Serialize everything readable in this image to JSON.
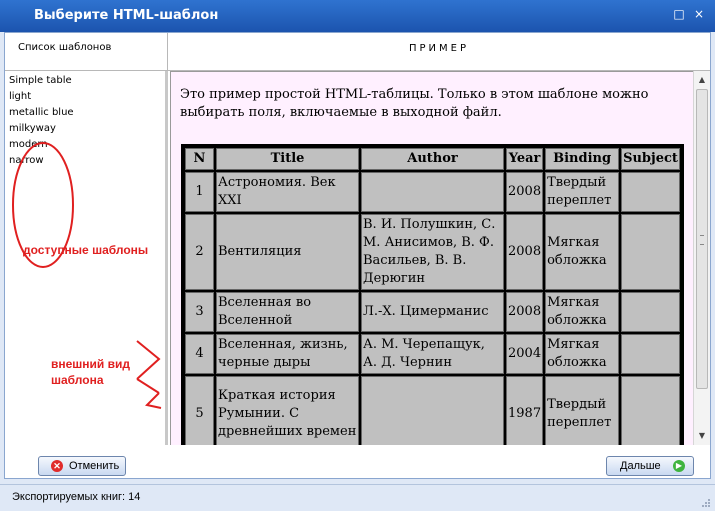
{
  "window": {
    "title": "Выберите HTML-шаблон",
    "controls": [
      "□",
      "×"
    ]
  },
  "headers": {
    "templates": "Список шаблонов",
    "preview": "ПРИМЕР"
  },
  "templates": [
    "Simple table",
    "light",
    "metallic blue",
    "milkyway",
    "modern",
    "narrow"
  ],
  "annotations": {
    "available": "доступные шаблоны",
    "appearance_line1": "внешний вид",
    "appearance_line2": "шаблона",
    "color": "#e02020"
  },
  "preview": {
    "intro": "Это пример простой HTML-таблицы. Только в этом шаблоне можно выбирать поля, включаемые в выходной файл.",
    "columns": [
      "N",
      "Title",
      "Author",
      "Year",
      "Binding",
      "Subject"
    ],
    "rows": [
      {
        "n": "1",
        "title": "Астрономия. Век XXI",
        "author": "",
        "year": "2008",
        "binding": "Твердый переплет",
        "subject": ""
      },
      {
        "n": "2",
        "title": "Вентиляция",
        "author": "В. И. Полушкин, С. М. Анисимов, В. Ф. Васильев, В. В. Дерюгин",
        "year": "2008",
        "binding": "Мягкая обложка",
        "subject": ""
      },
      {
        "n": "3",
        "title": "Вселенная во Вселенной",
        "author": "Л.-Х. Цимерманис",
        "year": "2008",
        "binding": "Мягкая обложка",
        "subject": ""
      },
      {
        "n": "4",
        "title": "Вселенная, жизнь, черные дыры",
        "author": "А. М. Черепащук, А. Д. Чернин",
        "year": "2004",
        "binding": "Мягкая обложка",
        "subject": ""
      },
      {
        "n": "5",
        "title": "Краткая история Румынии. С древнейших времен",
        "author": "",
        "year": "1987",
        "binding": "Твердый переплет",
        "subject": ""
      }
    ]
  },
  "buttons": {
    "cancel": "Отменить",
    "next": "Дальше"
  },
  "status": {
    "text": "Экспортируемых книг: 14"
  },
  "colors": {
    "titlebar": "#1c54ae",
    "preview_bg": "#fff0ff",
    "cell_bg": "#c0c0c0"
  }
}
